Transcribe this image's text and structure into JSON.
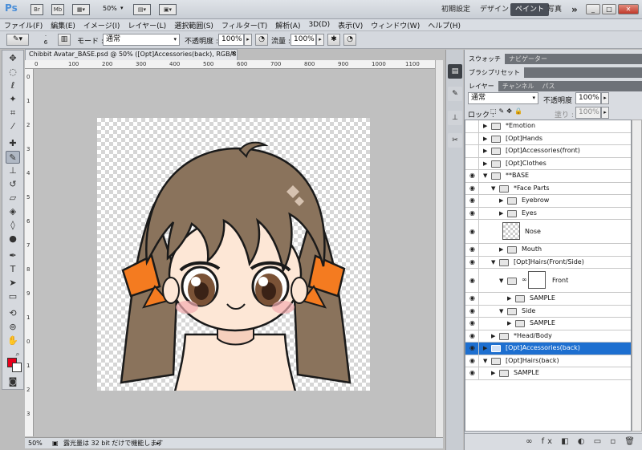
{
  "app": {
    "logo": "Ps",
    "icon_br": "Br",
    "icon_mb": "Mb",
    "zoom": "50%"
  },
  "workspaces": [
    "初期設定",
    "デザイン",
    "ペイント",
    "写真"
  ],
  "workspace_more": "»",
  "window_buttons": {
    "minimize": "_",
    "restore": "□",
    "close": "✕"
  },
  "menu": [
    "ファイル(F)",
    "編集(E)",
    "イメージ(I)",
    "レイヤー(L)",
    "選択範囲(S)",
    "フィルター(T)",
    "解析(A)",
    "3D(D)",
    "表示(V)",
    "ウィンドウ(W)",
    "ヘルプ(H)"
  ],
  "options": {
    "brush_size": "6",
    "mode_label": "モード :",
    "mode_value": "通常",
    "opacity_label": "不透明度 :",
    "opacity_value": "100%",
    "flow_label": "流量 :",
    "flow_value": "100%"
  },
  "document": {
    "tab_title": "Chibbit Avatar_BASE.psd @ 50% ([Opt]Accessories(back), RGB/8#) *",
    "tab_close": "×",
    "zoom": "50%",
    "status": "露光量は 32 bit だけで機能します"
  },
  "ruler": {
    "top": [
      "0",
      "100",
      "200",
      "300",
      "400",
      "500",
      "600",
      "700",
      "800",
      "900",
      "1000",
      "1100",
      "1200"
    ],
    "left": [
      "0",
      "1",
      "2",
      "3",
      "4",
      "5",
      "6",
      "7",
      "8",
      "9",
      "1",
      "0",
      "1",
      "2",
      "3"
    ]
  },
  "colors": {
    "foreground": "#e8001c",
    "background": "#ffffff",
    "selection": "#1d6fd0",
    "ribbon": "#f47b20",
    "hair": "#8a735c"
  },
  "panel": {
    "tabs_top": [
      "スウォッチ",
      "ナビゲーター"
    ],
    "tab_brush": "ブラシプリセット",
    "tabs_layers": [
      "レイヤー",
      "チャンネル",
      "パス"
    ],
    "blend_mode": "通常",
    "opacity_label": "不透明度 :",
    "opacity_value": "100%",
    "lock_label": "ロック :",
    "fill_label": "塗り :",
    "fill_value": "100%",
    "footer_icons": "∞ fx ◧ ◐ ▭ ▫ 🗑"
  },
  "layers": [
    {
      "name": "*Emotion",
      "visible": false,
      "indent": 0,
      "expanded": false,
      "kind": "folder"
    },
    {
      "name": "[Opt]Hands",
      "visible": false,
      "indent": 0,
      "expanded": false,
      "kind": "folder"
    },
    {
      "name": "[Opt]Accessories(front)",
      "visible": false,
      "indent": 0,
      "expanded": false,
      "kind": "folder"
    },
    {
      "name": "[Opt]Clothes",
      "visible": false,
      "indent": 0,
      "expanded": false,
      "kind": "folder"
    },
    {
      "name": "**BASE",
      "visible": true,
      "indent": 0,
      "expanded": true,
      "kind": "folder"
    },
    {
      "name": "*Face Parts",
      "visible": true,
      "indent": 1,
      "expanded": true,
      "kind": "folder"
    },
    {
      "name": "Eyebrow",
      "visible": true,
      "indent": 2,
      "expanded": false,
      "kind": "folder"
    },
    {
      "name": "Eyes",
      "visible": true,
      "indent": 2,
      "expanded": false,
      "kind": "folder"
    },
    {
      "name": "Nose",
      "visible": true,
      "indent": 2,
      "expanded": false,
      "kind": "layer"
    },
    {
      "name": "Mouth",
      "visible": true,
      "indent": 2,
      "expanded": false,
      "kind": "folder"
    },
    {
      "name": "[Opt]Hairs(Front/Side)",
      "visible": true,
      "indent": 1,
      "expanded": true,
      "kind": "folder"
    },
    {
      "name": "Front",
      "visible": true,
      "indent": 2,
      "expanded": true,
      "kind": "masked"
    },
    {
      "name": "SAMPLE",
      "visible": true,
      "indent": 3,
      "expanded": false,
      "kind": "folder"
    },
    {
      "name": "Side",
      "visible": true,
      "indent": 2,
      "expanded": true,
      "kind": "folder"
    },
    {
      "name": "SAMPLE",
      "visible": true,
      "indent": 3,
      "expanded": false,
      "kind": "folder"
    },
    {
      "name": "*Head/Body",
      "visible": true,
      "indent": 1,
      "expanded": false,
      "kind": "folder"
    },
    {
      "name": "[Opt]Accessories(back)",
      "visible": true,
      "indent": 0,
      "expanded": false,
      "kind": "folder",
      "selected": true
    },
    {
      "name": "[Opt]Hairs(back)",
      "visible": true,
      "indent": 0,
      "expanded": true,
      "kind": "folder"
    },
    {
      "name": "SAMPLE",
      "visible": true,
      "indent": 1,
      "expanded": false,
      "kind": "folder"
    }
  ]
}
